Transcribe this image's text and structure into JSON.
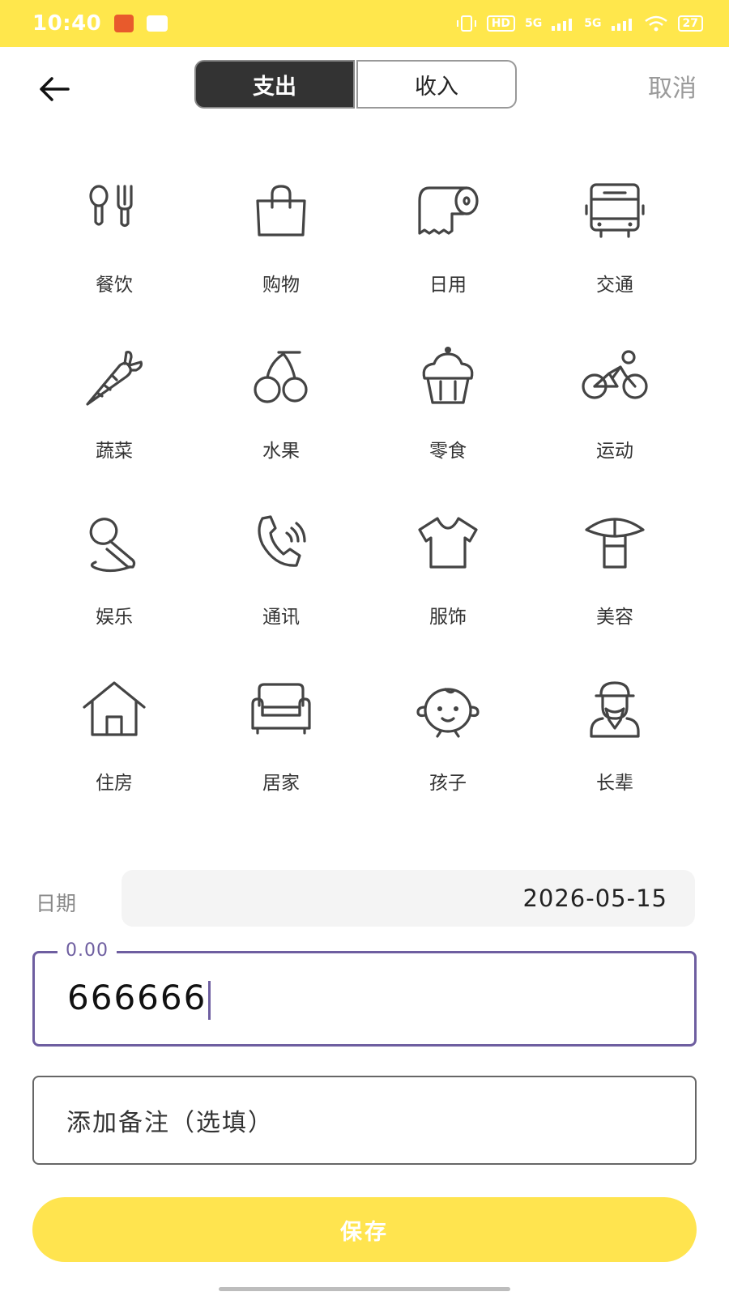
{
  "status_bar": {
    "time": "10:40",
    "network_label_1": "HD",
    "network_label_2": "5G",
    "network_label_3": "5G",
    "battery": "27",
    "accent_color": "#FFE74C"
  },
  "top_bar": {
    "tabs": [
      {
        "label": "支出",
        "active": true
      },
      {
        "label": "收入",
        "active": false
      }
    ],
    "cancel_label": "取消"
  },
  "categories": [
    {
      "label": "餐饮",
      "icon": "utensils-icon"
    },
    {
      "label": "购物",
      "icon": "shopping-bag-icon"
    },
    {
      "label": "日用",
      "icon": "paper-roll-icon"
    },
    {
      "label": "交通",
      "icon": "bus-icon"
    },
    {
      "label": "蔬菜",
      "icon": "carrot-icon"
    },
    {
      "label": "水果",
      "icon": "cherry-icon"
    },
    {
      "label": "零食",
      "icon": "cupcake-icon"
    },
    {
      "label": "运动",
      "icon": "cyclist-icon"
    },
    {
      "label": "娱乐",
      "icon": "microphone-icon"
    },
    {
      "label": "通讯",
      "icon": "phone-icon"
    },
    {
      "label": "服饰",
      "icon": "tshirt-icon"
    },
    {
      "label": "美容",
      "icon": "cosmetic-icon"
    },
    {
      "label": "住房",
      "icon": "house-icon"
    },
    {
      "label": "居家",
      "icon": "sofa-icon"
    },
    {
      "label": "孩子",
      "icon": "baby-face-icon"
    },
    {
      "label": "长辈",
      "icon": "elder-icon"
    }
  ],
  "form": {
    "date_label": "日期",
    "date_value": "2026-05-15",
    "amount_placeholder": "0.00",
    "amount_value": "666666",
    "note_placeholder": "添加备注（选填）",
    "save_label": "保存"
  }
}
